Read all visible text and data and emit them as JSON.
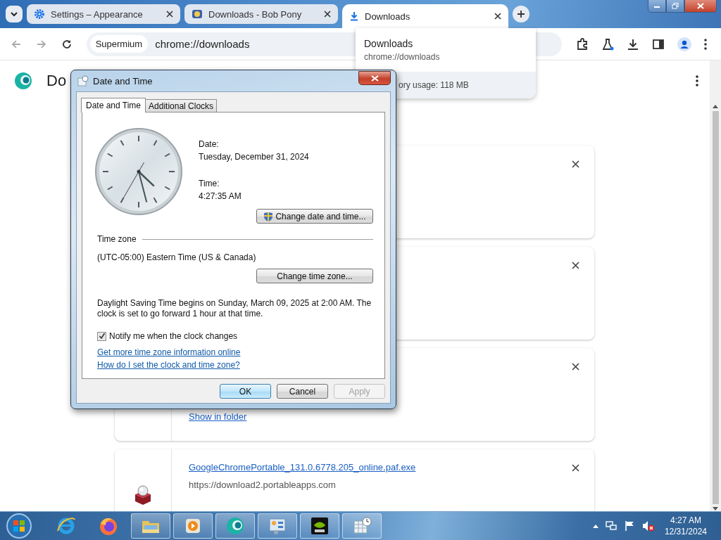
{
  "tabs": [
    {
      "title": "Settings – Appearance",
      "kind": "settings",
      "selected": false
    },
    {
      "title": "Downloads - Bob Pony",
      "kind": "page",
      "selected": false
    },
    {
      "title": "Downloads",
      "kind": "download",
      "selected": true
    }
  ],
  "toolbar": {
    "chip": "Supermium",
    "url": "chrome://downloads"
  },
  "hover_card": {
    "title": "Downloads",
    "url": "chrome://downloads",
    "memory": "ory usage: 118 MB"
  },
  "page": {
    "title": "Do"
  },
  "downloads": [
    {
      "kind": "covered"
    },
    {
      "kind": "covered"
    },
    {
      "kind": "folder_link",
      "link": "Show in folder"
    },
    {
      "kind": "file",
      "file": "GoogleChromePortable_131.0.6778.205_online.paf.exe",
      "source": "https://download2.portableapps.com"
    }
  ],
  "dialog": {
    "title": "Date and Time",
    "tabs": [
      {
        "label": "Date and Time",
        "selected": true
      },
      {
        "label": "Additional Clocks",
        "selected": false
      }
    ],
    "date_label": "Date:",
    "date": "Tuesday, December 31, 2024",
    "time_label": "Time:",
    "time": "4:27:35 AM",
    "change_datetime": "Change date and time...",
    "timezone_heading": "Time zone",
    "timezone": "(UTC-05:00) Eastern Time (US & Canada)",
    "change_timezone": "Change time zone...",
    "dst_note": "Daylight Saving Time begins on Sunday, March 09, 2025 at 2:00 AM. The clock is set to go forward 1 hour at that time.",
    "notify": {
      "label": "Notify me when the clock changes",
      "checked": true
    },
    "links": [
      "Get more time zone information online",
      "How do I set the clock and time zone?"
    ],
    "buttons": [
      {
        "label": "OK",
        "kind": "default",
        "disabled": false
      },
      {
        "label": "Cancel",
        "kind": "normal",
        "disabled": false
      },
      {
        "label": "Apply",
        "kind": "normal",
        "disabled": true
      }
    ]
  },
  "taskbar": {
    "apps": [
      {
        "kind": "ie",
        "running": false
      },
      {
        "kind": "firefox",
        "running": false
      },
      {
        "kind": "explorer",
        "running": true
      },
      {
        "kind": "media",
        "running": true
      },
      {
        "kind": "browser",
        "running": true
      },
      {
        "kind": "control",
        "running": true
      },
      {
        "kind": "nvidia",
        "running": true
      },
      {
        "kind": "datetime",
        "running": true
      }
    ],
    "time": "4:27 AM",
    "date": "12/31/2024"
  }
}
